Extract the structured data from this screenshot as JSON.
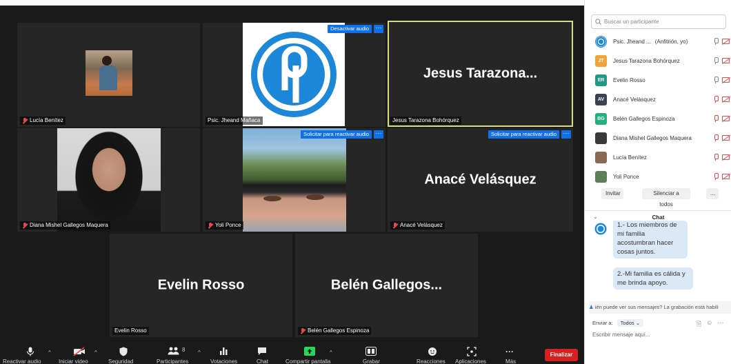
{
  "tiles": {
    "lucia": {
      "name": "Lucía Benítez"
    },
    "host": {
      "name": "Psic. Jheand Mañaca",
      "audio_button": "Desactivar audio"
    },
    "jesus": {
      "name": "Jesus Tarazona Bohórquez",
      "big_name": "Jesus  Tarazona..."
    },
    "diana": {
      "name": "Diana Mishel Gallegos Maquera"
    },
    "yoli": {
      "name": "Yoli Ponce",
      "audio_button": "Solicitar para reactivar audio"
    },
    "anace": {
      "name": "Anacé Velásquez",
      "big_name": "Anacé Velásquez",
      "audio_button": "Solicitar para reactivar audio"
    },
    "evelin": {
      "name": "Evelin Rosso",
      "big_name": "Evelin Rosso"
    },
    "belen": {
      "name": "Belén Gallegos Espinoza",
      "big_name": "Belén  Gallegos..."
    },
    "more_dots": "···"
  },
  "toolbar": {
    "participants_count": "8",
    "end_label": "Finalizar",
    "labels": [
      "Reactivar audio",
      "Iniciar video",
      "Seguridad",
      "Participantes",
      "Votaciones",
      "Chat",
      "Compartir pantalla",
      "Grabar",
      "Reacciones",
      "Aplicaciones",
      "Más"
    ]
  },
  "panel": {
    "search_placeholder": "Buscar un participante",
    "participants": [
      {
        "initials": "",
        "name": "Psic. Jheand ...",
        "role": "(Anfitrión, yo)",
        "color": "#ffffff"
      },
      {
        "initials": "JT",
        "name": "Jesus Tarazona Bohórquez",
        "role": "",
        "color": "#f2a33a"
      },
      {
        "initials": "ER",
        "name": "Evelin Rosso",
        "role": "",
        "color": "#1f9a86"
      },
      {
        "initials": "AV",
        "name": "Anacé Velásquez",
        "role": "",
        "color": "#3b4350"
      },
      {
        "initials": "BG",
        "name": "Belén Gallegos Espinoza",
        "role": "",
        "color": "#22b07d"
      },
      {
        "initials": "",
        "name": "Diana Mishel Gallegos Maquera",
        "role": "",
        "color": "#3a3a3a"
      },
      {
        "initials": "",
        "name": "Lucía Benítez",
        "role": "",
        "color": "#8a6a55"
      },
      {
        "initials": "",
        "name": "Yoli Ponce",
        "role": "",
        "color": "#5f7f5a"
      }
    ],
    "invite_label": "Invitar",
    "mute_all_label": "Silenciar a todos",
    "more_label": "...",
    "chat_title": "Chat",
    "messages": [
      {
        "text": "1.- Los miembros de mi familia acostumbran hacer cosas juntos."
      },
      {
        "text": "2.-Mi familia es cálida y me brinda apoyo."
      }
    ],
    "recording_note": "ién puede ver sus mensajes? La grabación está habili",
    "send_to_label": "Enviar a:",
    "send_to_value": "Todos",
    "chat_placeholder": "Escribir mensaje aquí..."
  }
}
